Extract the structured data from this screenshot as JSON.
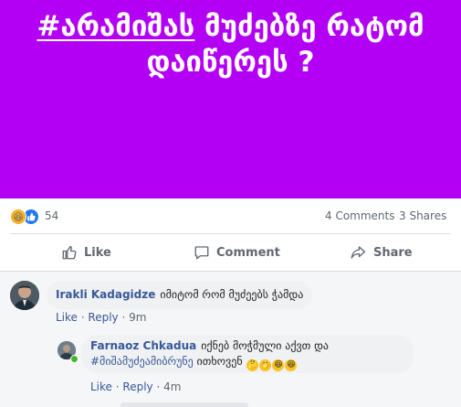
{
  "banner": {
    "hashtag": "#არამიშას",
    "line1_rest": " მუძებზე რატომ",
    "line2": "დაიწერეს ?",
    "bg_color": "#b300f5"
  },
  "stats": {
    "reaction_count": "54",
    "comments": "4 Comments",
    "shares": "3 Shares",
    "reaction_icons": [
      "haha-reaction-icon",
      "like-reaction-icon"
    ]
  },
  "actions": {
    "like": "Like",
    "comment": "Comment",
    "share": "Share"
  },
  "comments": [
    {
      "author": "Irakli Kadagidze",
      "text": "იმიტომ რომ მუძეებს ჭამდა",
      "like": "Like",
      "reply": "Reply",
      "time": "9m"
    },
    {
      "author": "Farnaoz Chkadua",
      "text": "იქნებ მოჭმული აქვთ და",
      "hashtag": "#მიშამუძეამიბრუნე",
      "text2": "ითხოვენ",
      "emojis": [
        "🤔",
        "🤭",
        "😆",
        "😆"
      ],
      "like": "Like",
      "reply": "Reply",
      "time": "4m"
    }
  ],
  "meta_separator": " · "
}
